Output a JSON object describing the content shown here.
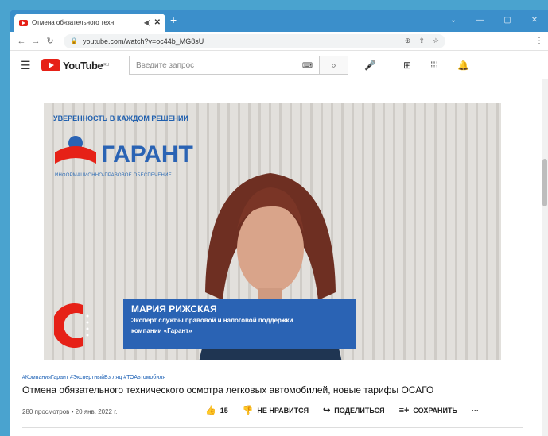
{
  "browser": {
    "tab_title": "Отмена обязательного техн",
    "tab_sound_icon": "speaker-icon",
    "tab_close": "✕",
    "new_tab": "+",
    "window_controls": [
      "⌄",
      "—",
      "▢",
      "✕"
    ],
    "url": "youtube.com/watch?v=oc44b_MG8sU"
  },
  "youtube": {
    "logo_text": "YouTube",
    "logo_region": "RU",
    "search_placeholder": "Введите запрос"
  },
  "video": {
    "brand_tagline": "УВЕРЕННОСТЬ В КАЖДОМ РЕШЕНИИ",
    "brand_logo": "ГАРАНТ",
    "brand_subtitle": "ИНФОРМАЦИОННО-ПРАВОВОЕ ОБЕСПЕЧЕНИЕ",
    "speaker_name": "МАРИЯ РИЖСКАЯ",
    "speaker_role_1": "Эксперт службы правовой и налоговой поддержки",
    "speaker_role_2": "компании «Гарант»"
  },
  "info": {
    "hashtags": "#КомпанияГарант #ЭкспертныйВзгляд #ТОАвтомобиля",
    "title": "Отмена обязательного технического осмотра легковых автомобилей, новые тарифы ОСАГО",
    "views_date": "280 просмотров • 20 янв. 2022 г.",
    "likes": "15",
    "dislike": "НЕ НРАВИТСЯ",
    "share": "ПОДЕЛИТЬСЯ",
    "save": "СОХРАНИТЬ",
    "more": "···"
  },
  "colors": {
    "accent_red": "#e62117",
    "garant_blue": "#2a63b4",
    "desktop": "#4aa3cf"
  }
}
